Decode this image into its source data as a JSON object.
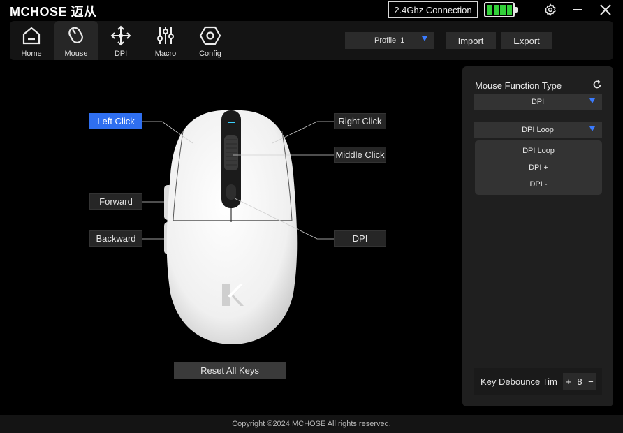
{
  "app": {
    "brand": "MCHOSE 迈从"
  },
  "titlebar": {
    "connection": "2.4Ghz Connection",
    "battery_level": 1.0,
    "battery_color": "#33d13a",
    "icons": [
      "gear-icon",
      "minimize-icon",
      "close-icon"
    ]
  },
  "nav": {
    "items": [
      {
        "label": "Home",
        "icon": "home-icon"
      },
      {
        "label": "Mouse",
        "icon": "mouse-icon"
      },
      {
        "label": "DPI",
        "icon": "move-arrows-icon"
      },
      {
        "label": "Macro",
        "icon": "sliders-icon"
      },
      {
        "label": "Config",
        "icon": "hexagon-icon"
      }
    ],
    "active": "Mouse"
  },
  "toolbar": {
    "profile_label": "Profile",
    "profile_value": "1",
    "import_label": "Import",
    "export_label": "Export",
    "accent": "#3a7bff"
  },
  "mouse": {
    "buttons": {
      "left_click": "Left Click",
      "right_click": "Right Click",
      "middle_click": "Middle Click",
      "forward": "Forward",
      "backward": "Backward",
      "dpi": "DPI"
    },
    "selected": "Left Click",
    "reset_label": "Reset All Keys"
  },
  "panel": {
    "title": "Mouse Function Type",
    "function_type": "DPI",
    "dpi_function": "DPI Loop",
    "options": [
      "DPI Loop",
      "DPI +",
      "DPI -"
    ],
    "debounce_label": "Key Debounce Tim",
    "debounce_value": "8",
    "plus": "+",
    "minus": "−"
  },
  "footer": {
    "copyright": "Copyright ©2024 MCHOSE All rights reserved."
  }
}
